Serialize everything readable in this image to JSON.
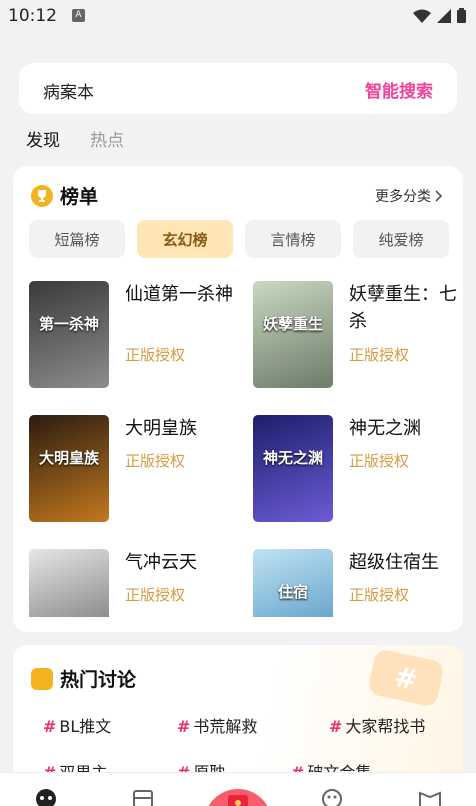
{
  "status_bar": {
    "time": "10:12",
    "notif_icon": "A"
  },
  "search": {
    "value": "病案本",
    "button_label": "智能搜索"
  },
  "tabs": [
    {
      "label": "发现",
      "active": true
    },
    {
      "label": "热点",
      "active": false
    }
  ],
  "ranking": {
    "title": "榜单",
    "more_label": "更多分类",
    "chips": [
      {
        "label": "短篇榜",
        "active": false
      },
      {
        "label": "玄幻榜",
        "active": true
      },
      {
        "label": "言情榜",
        "active": false
      },
      {
        "label": "纯爱榜",
        "active": false
      }
    ],
    "books": [
      {
        "title": "仙道第一杀神",
        "tag": "正版授权",
        "cover_text": "第一杀神",
        "cover_colors": [
          "#3a3a3a",
          "#8d8d8d"
        ]
      },
      {
        "title": "妖孽重生：七杀",
        "tag": "正版授权",
        "cover_text": "妖孽重生",
        "cover_colors": [
          "#c9d8c0",
          "#6d7b6a"
        ]
      },
      {
        "title": "大明皇族",
        "tag": "正版授权",
        "cover_text": "大明皇族",
        "cover_colors": [
          "#2b1c10",
          "#c2781f"
        ]
      },
      {
        "title": "神无之渊",
        "tag": "正版授权",
        "cover_text": "神无之渊",
        "cover_colors": [
          "#1c1f6b",
          "#6c5bd6"
        ]
      },
      {
        "title": "气冲云天",
        "tag": "正版授权",
        "cover_text": "",
        "cover_colors": [
          "#e6e6e6",
          "#6a6a6a"
        ]
      },
      {
        "title": "超级住宿生",
        "tag": "正版授权",
        "cover_text": "住宿",
        "cover_colors": [
          "#bfe2f2",
          "#4a8fbf"
        ]
      }
    ]
  },
  "hot_topics": {
    "title": "热门讨论",
    "deco_symbol": "#",
    "topics": [
      {
        "label": "BL推文"
      },
      {
        "label": "书荒解救"
      },
      {
        "label": "大家帮找书"
      },
      {
        "label": "双男主"
      },
      {
        "label": "原耽"
      },
      {
        "label": "破文合集"
      }
    ]
  },
  "colors": {
    "accent_pink": "#f0449a",
    "tag_gold": "#d69b40",
    "chip_active_bg": "#fde5b5"
  }
}
